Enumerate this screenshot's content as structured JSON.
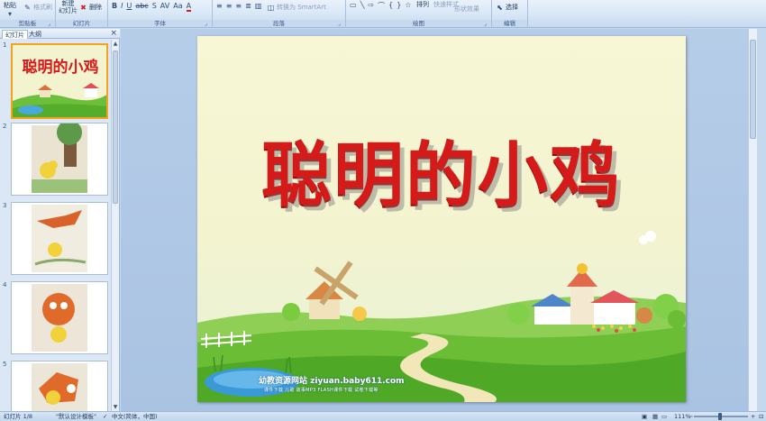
{
  "ribbon": {
    "clipboard": {
      "paste": "粘贴",
      "format_painter": "格式刷",
      "label": "剪贴板"
    },
    "slides": {
      "new_slide": "新建",
      "new_slide2": "幻灯片",
      "delete": "删除",
      "label": "幻灯片"
    },
    "font": {
      "label": "字体"
    },
    "paragraph": {
      "smartart": "转换为 SmartArt",
      "label": "段落"
    },
    "drawing": {
      "arrange": "排列",
      "quick_styles": "快速样式",
      "shape_effects": "形状效果",
      "label": "绘图"
    },
    "editing": {
      "select": "选择",
      "label": "编辑"
    }
  },
  "panel": {
    "tab_slides": "幻灯片",
    "tab_outline": "大纲",
    "close": "×",
    "thumbnails": [
      {
        "num": "1",
        "caption": "聪明的小鸡"
      },
      {
        "num": "2",
        "caption": ""
      },
      {
        "num": "3",
        "caption": ""
      },
      {
        "num": "4",
        "caption": ""
      },
      {
        "num": "5",
        "caption": ""
      }
    ]
  },
  "slide": {
    "title": "聪明的小鸡",
    "footer_site": "幼教资源网站  ziyuan.baby611.com",
    "footer_links": "课件下载   儿歌   故事MP3   FLASH课件下载   试卷下载等"
  },
  "status": {
    "slide_count": "幻灯片 1/8",
    "theme": "\"默认设计模板\"",
    "language": "中文(简体，中国)",
    "zoom": "111%"
  },
  "colors": {
    "title_red": "#d51a1a",
    "selection_orange": "#f6a21c",
    "ribbon_blue": "#d6e5f5"
  }
}
